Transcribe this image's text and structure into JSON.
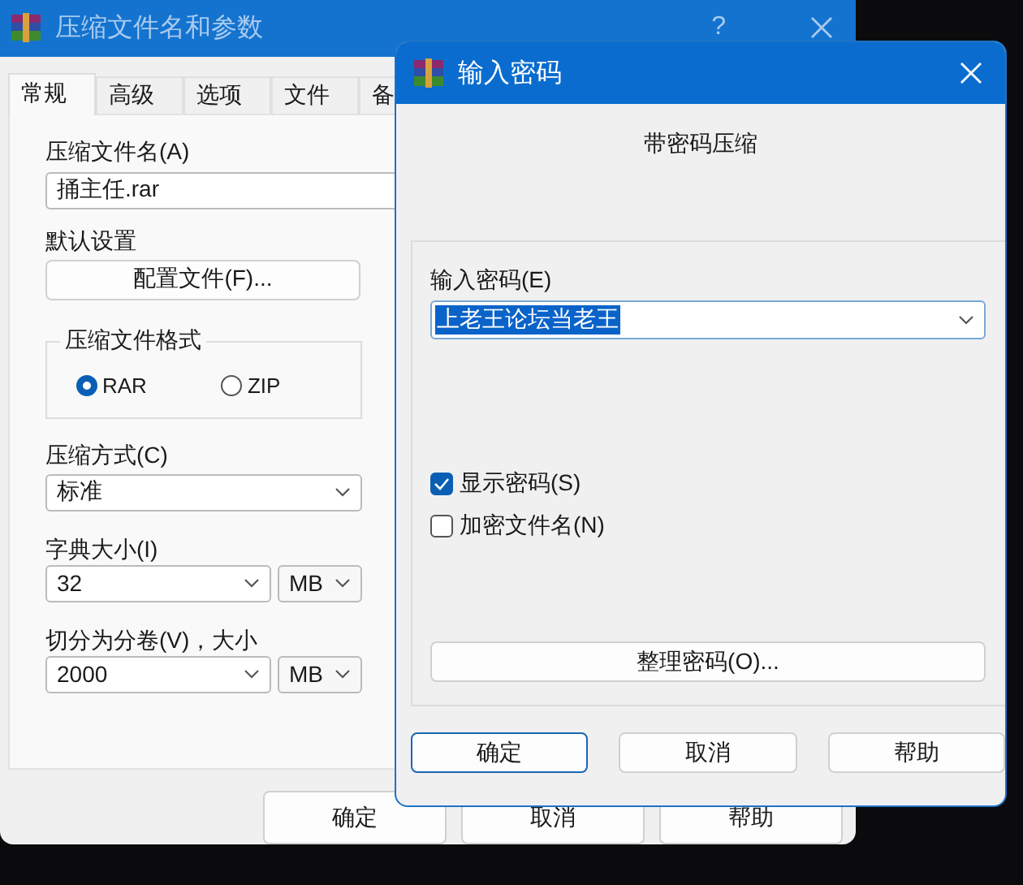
{
  "back_window": {
    "title": "压缩文件名和参数",
    "help": "?",
    "tabs": [
      {
        "label": "常规",
        "selected": true
      },
      {
        "label": "高级",
        "selected": false
      },
      {
        "label": "选项",
        "selected": false
      },
      {
        "label": "文件",
        "selected": false
      },
      {
        "label": "备",
        "selected": false
      }
    ],
    "archive_name": {
      "label": "压缩文件名(A)",
      "value": "捅主任.rar"
    },
    "defaults": {
      "label": "默认设置",
      "button": "配置文件(F)..."
    },
    "format": {
      "title": "压缩文件格式",
      "options": [
        {
          "label": "RAR",
          "selected": true
        },
        {
          "label": "ZIP",
          "selected": false
        }
      ]
    },
    "method": {
      "label": "压缩方式(C)",
      "value": "标准"
    },
    "dictionary": {
      "label": "字典大小(I)",
      "value": "32",
      "unit": "MB"
    },
    "volume": {
      "label": "切分为分卷(V)，大小",
      "value": "2000",
      "unit": "MB"
    },
    "buttons": [
      "确定",
      "取消",
      "帮助"
    ]
  },
  "dialog": {
    "title": "输入密码",
    "heading": "带密码压缩",
    "password": {
      "label": "输入密码(E)",
      "value": "上老王论坛当老王"
    },
    "options": [
      {
        "label": "显示密码(S)",
        "checked": true
      },
      {
        "label": "加密文件名(N)",
        "checked": false
      }
    ],
    "organize_button": "整理密码(O)...",
    "buttons": [
      {
        "label": "确定",
        "default": true
      },
      {
        "label": "取消",
        "default": false
      },
      {
        "label": "帮助",
        "default": false
      }
    ]
  }
}
